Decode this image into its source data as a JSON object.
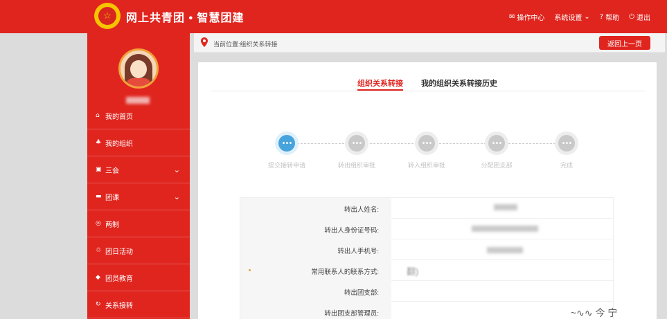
{
  "header": {
    "title": "网上共青团 • 智慧团建",
    "logo_glyph": "☆",
    "nav": [
      {
        "icon": "mail-icon",
        "glyph": "✉",
        "label": "操作中心"
      },
      {
        "icon": "chevron-down-icon",
        "glyph": "⌄",
        "label": "系统设置"
      },
      {
        "icon": "help-icon",
        "glyph": "?",
        "label": "帮助"
      },
      {
        "icon": "power-icon",
        "glyph": "⏻",
        "label": "退出"
      }
    ]
  },
  "sidebar": {
    "items": [
      {
        "label": "我的首页",
        "glyph": "⌂"
      },
      {
        "label": "我的组织",
        "glyph": "♣"
      },
      {
        "label": "三会",
        "glyph": "▣",
        "chevron": "⌄"
      },
      {
        "label": "团课",
        "glyph": "▬",
        "chevron": "⌄"
      },
      {
        "label": "两制",
        "glyph": "◎"
      },
      {
        "label": "团日活动",
        "glyph": "♲"
      },
      {
        "label": "团员教育",
        "glyph": "◆"
      },
      {
        "label": "关系接转",
        "glyph": "↻"
      }
    ]
  },
  "breadcrumb": {
    "text": "当前位置:组织关系转接",
    "back_label": "返回上一页"
  },
  "tabs": [
    {
      "label": "组织关系转接",
      "active": true
    },
    {
      "label": "我的组织关系转接历史",
      "active": false
    }
  ],
  "steps": [
    {
      "label": "提交接转申请",
      "glyph": "•••",
      "current": true
    },
    {
      "label": "转出组织审批",
      "glyph": "•••",
      "current": false
    },
    {
      "label": "转入组织审批",
      "glyph": "•••",
      "current": false
    },
    {
      "label": "分配团支部",
      "glyph": "•••",
      "current": false
    },
    {
      "label": "完成",
      "glyph": "•••",
      "current": false
    }
  ],
  "form": {
    "rows": [
      {
        "label": "转出人姓名:"
      },
      {
        "label": "转出人身份证号码:"
      },
      {
        "label": "转出人手机号:"
      },
      {
        "label": "常用联系人的联系方式:",
        "required": true,
        "value": "翻)"
      },
      {
        "label": "转出团支部:"
      },
      {
        "label": "转出团支部管理员:"
      }
    ]
  },
  "colors": {
    "primary": "#e0251f",
    "step_current": "#47a3dc",
    "step_pending": "#c9c9c9"
  },
  "watermark": "~∿∿ 今 宁"
}
